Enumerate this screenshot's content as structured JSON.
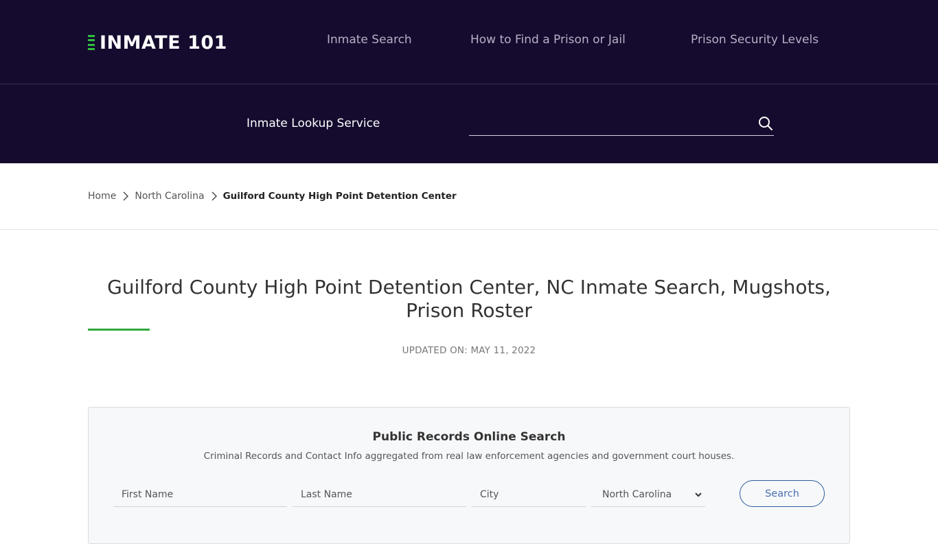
{
  "brand": {
    "logo_text": "INMATE 101",
    "accent_color": "#2fbf3e",
    "header_bg": "#150b2e"
  },
  "nav": {
    "items": [
      {
        "label": "Inmate Search"
      },
      {
        "label": "How to Find a Prison or Jail"
      },
      {
        "label": "Prison Security Levels"
      }
    ]
  },
  "lookup": {
    "label": "Inmate Lookup Service",
    "input_value": "",
    "search_icon": "search-icon"
  },
  "breadcrumb": {
    "items": [
      {
        "label": "Home"
      },
      {
        "label": "North Carolina"
      }
    ],
    "current": "Guilford County High Point Detention Center",
    "separator_icon": "chevron-right-icon"
  },
  "page": {
    "title": "Guilford County High Point Detention Center, NC Inmate Search, Mugshots, Prison Roster",
    "updated": "UPDATED ON: MAY 11, 2022"
  },
  "records_search": {
    "title": "Public Records Online Search",
    "subtitle": "Criminal Records and Contact Info aggregated from real law enforcement agencies and government court houses.",
    "first_name_placeholder": "First Name",
    "last_name_placeholder": "Last Name",
    "city_placeholder": "City",
    "state_selected": "North Carolina",
    "search_label": "Search"
  }
}
